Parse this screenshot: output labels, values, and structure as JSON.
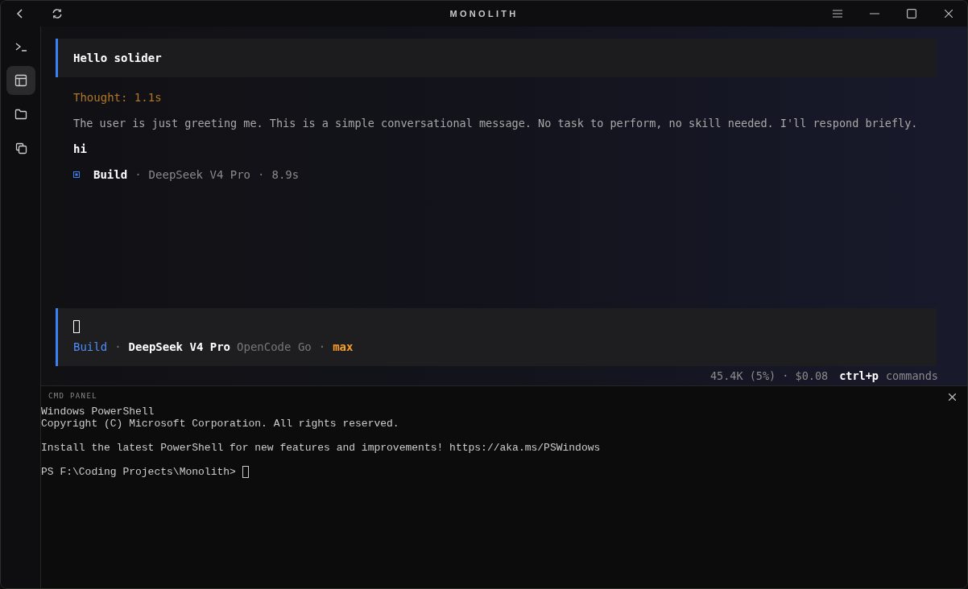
{
  "window": {
    "title": "MONOLITH"
  },
  "sidebar": {
    "items": [
      {
        "selected": false
      },
      {
        "selected": true
      },
      {
        "selected": false
      },
      {
        "selected": false
      }
    ]
  },
  "chat": {
    "user_message": "Hello solider",
    "thought": "Thought: 1.1s",
    "reasoning": "The user is just greeting me. This is a simple conversational message. No task to perform, no skill needed. I'll respond briefly.",
    "reply": "hi",
    "meta": {
      "agent": "Build",
      "sep1": "·",
      "model": "DeepSeek V4 Pro",
      "sep2": "·",
      "duration": "8.9s"
    }
  },
  "prompt": {
    "agent": "Build",
    "sep1": "·",
    "model": "DeepSeek V4 Pro",
    "provider": "OpenCode Go",
    "sep2": "·",
    "variant": "max"
  },
  "status": {
    "usage": "45.4K (5%) · $0.08",
    "shortcut": "ctrl+p",
    "shortcut_label": "commands"
  },
  "cmd_panel": {
    "title": "CMD PANEL",
    "blocks": [
      [
        "Windows PowerShell",
        "Copyright (C) Microsoft Corporation. All rights reserved."
      ],
      [
        "Install the latest PowerShell for new features and improvements! https://aka.ms/PSWindows"
      ]
    ],
    "prompt": "PS F:\\Coding Projects\\Monolith>"
  }
}
